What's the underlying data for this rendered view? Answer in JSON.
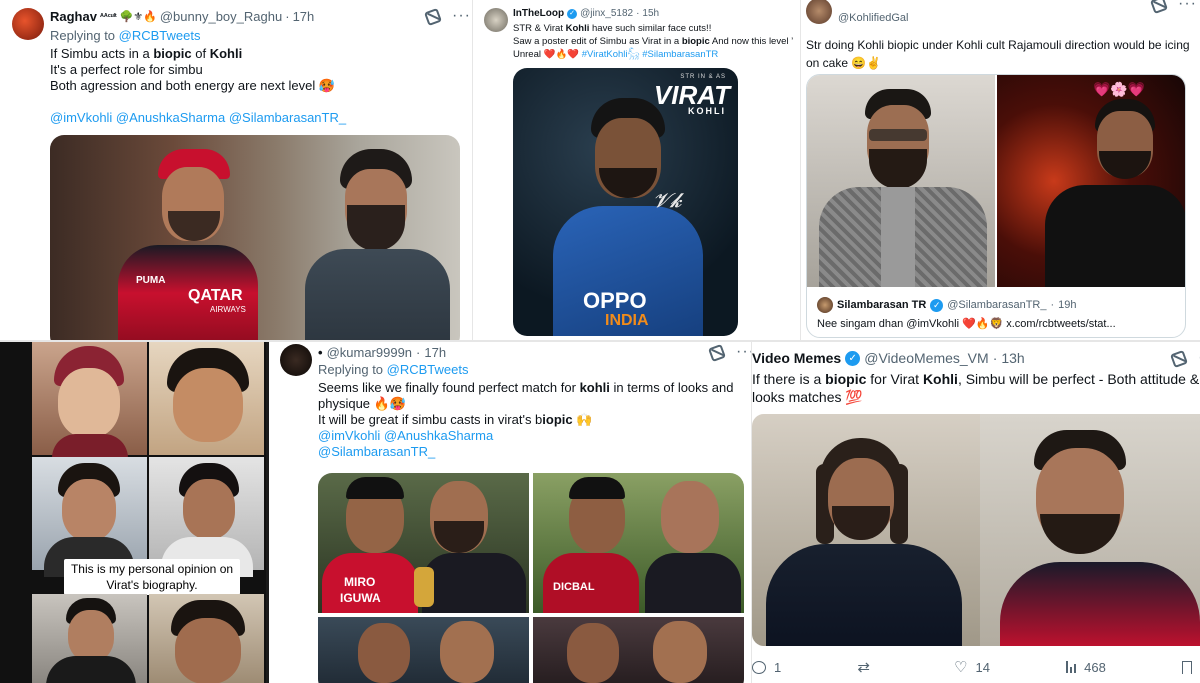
{
  "tweet1": {
    "display_name": "Raghav",
    "name_suffix": "ᴬᴬᶜᵘˡᵗ",
    "emojis": "🌳⚜🔥",
    "handle": "@bunny_boy_Raghu",
    "time": "17h",
    "replying_prefix": "Replying to ",
    "replying_to": "@RCBTweets",
    "line1_a": "If Simbu acts in a ",
    "line1_b": "biopic",
    "line1_c": " of ",
    "line1_d": "Kohli",
    "line2": "It's a perfect role for simbu",
    "line3": "Both agression and both energy are next level 🥵",
    "mentions": "@imVkohli @AnushkaSharma @SilambarasanTR_",
    "image_text_qatar": "QATAR",
    "image_text_airways": "AIRWAYS",
    "image_text_puma": "PUMA"
  },
  "tweet2": {
    "display_name": "InTheLoop",
    "handle": "@jinx_5182",
    "time": "15h",
    "line1_a": "STR & Virat ",
    "line1_b": "Kohli",
    "line1_c": " have such similar face cuts!!",
    "line2_a": "Saw a poster edit of Simbu as Virat in a ",
    "line2_b": "biopic",
    "line2_c": " And now this level ’",
    "line3": "Unreal ❤️🔥❤️ ",
    "hashtags": "#ViratKohli𓃵 #SilambarasanTR",
    "poster_small": "STR IN & AS",
    "poster_title": "VIRAT",
    "poster_sub": "KOHLI",
    "jersey_text": "OPPO",
    "jersey_text2": "INDIA"
  },
  "tweet3": {
    "display_name": "\"",
    "handle": "@KohlifiedGal",
    "line1": "Str doing Kohli biopic under Kohli cult Rajamouli direction would be icing",
    "line2": "on cake 😄✌️",
    "quote_name": "Silambarasan TR",
    "quote_handle": "@SilambarasanTR_",
    "quote_time": "19h",
    "quote_text_a": "Nee singam dhan @imVkohli ❤️🔥🦁 ",
    "quote_link": "x.com/rcbtweets/stat..."
  },
  "collage": {
    "caption": "This is my personal opinion on Virat's biography."
  },
  "tweet4": {
    "display_name": "•",
    "handle": "@kumar9999n",
    "time": "17h",
    "replying_prefix": "Replying to ",
    "replying_to": "@RCBTweets",
    "line1_a": "Seems like we finally found perfect match for ",
    "line1_b": "kohli",
    "line1_c": " in terms of looks and",
    "line2": "physique 🔥🥵",
    "line3_a": "It will be great if simbu casts in virat's b",
    "line3_b": "iopic",
    "line3_c": " 🙌",
    "mentions1": "@imVkohli @AnushkaSharma",
    "mentions2": "@SilambarasanTR_",
    "image_text_miro": "MIRO",
    "image_text_iguwa": "IGUWA",
    "image_text_dicbal": "DICBAL"
  },
  "tweet5": {
    "display_name": "Video Memes",
    "handle": "@VideoMemes_VM",
    "time": "13h",
    "line1_a": "If there is a ",
    "line1_b": "biopic",
    "line1_c": " for Virat ",
    "line1_d": "Kohli",
    "line1_e": ", Simbu will be perfect - Both attitude &",
    "line2": "looks matches 💯",
    "replies": "1",
    "reposts": "",
    "likes": "14",
    "views": "468"
  },
  "colors": {
    "link": "#1d9bf0",
    "text": "#0f1419",
    "muted": "#536471",
    "rcb_red": "#c8102e",
    "india_blue": "#1a4f9c"
  }
}
